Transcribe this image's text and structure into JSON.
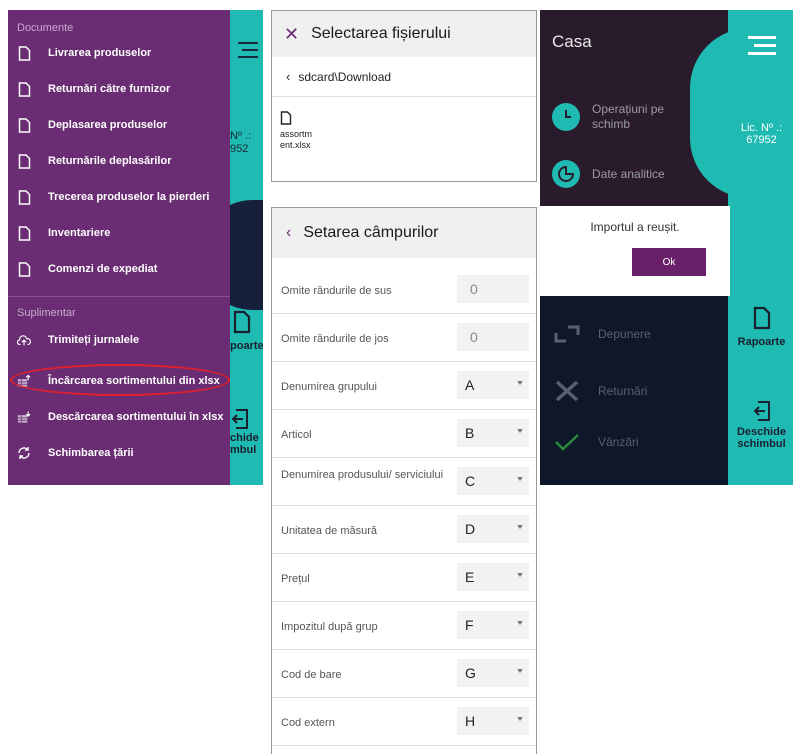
{
  "drawer": {
    "section_documents": "Documente",
    "documents": [
      {
        "label": "Livrarea produselor",
        "icon": "document-icon"
      },
      {
        "label": "Returnări către furnizor",
        "icon": "document-icon"
      },
      {
        "label": "Deplasarea produselor",
        "icon": "document-icon"
      },
      {
        "label": "Returnările deplasărilor",
        "icon": "document-icon"
      },
      {
        "label": "Trecerea produselor la pierderi",
        "icon": "document-icon"
      },
      {
        "label": "Inventariere",
        "icon": "document-icon"
      },
      {
        "label": "Comenzi de expediat",
        "icon": "document-icon"
      }
    ],
    "section_extra": "Suplimentar",
    "extra": [
      {
        "label": "Trimiteți jurnalele",
        "icon": "cloud-upload-icon"
      },
      {
        "label": "Încărcarea sortimentului din xlsx",
        "icon": "spreadsheet-upload-icon"
      },
      {
        "label": "Descărcarea sortimentului în xlsx",
        "icon": "spreadsheet-download-icon"
      },
      {
        "label": "Schimbarea țării",
        "icon": "refresh-icon"
      }
    ],
    "background": {
      "lic_text": "Nº .:",
      "lic_number": "952",
      "reports_fragment": "poarte",
      "open_shift_fragment_1": "chide",
      "open_shift_fragment_2": "mbul"
    }
  },
  "file_selector": {
    "title": "Selectarea fișierului",
    "path": "sdcard\\Download",
    "file_name": "assortm ent.xlsx"
  },
  "field_settings": {
    "title": "Setarea câmpurilor",
    "fields": [
      {
        "label": "Omite rândurile de sus",
        "value": "0",
        "kind": "number"
      },
      {
        "label": "Omite rândurile de jos",
        "value": "0",
        "kind": "number"
      },
      {
        "label": "Denumirea grupului",
        "value": "A",
        "kind": "select"
      },
      {
        "label": "Articol",
        "value": "B",
        "kind": "select"
      },
      {
        "label": "Denumirea produsului/ serviciului",
        "value": "C",
        "kind": "select"
      },
      {
        "label": "Unitatea de măsură",
        "value": "D",
        "kind": "select"
      },
      {
        "label": "Prețul",
        "value": "E",
        "kind": "select"
      },
      {
        "label": "Impozitul după grup",
        "value": "F",
        "kind": "select"
      },
      {
        "label": "Cod de bare",
        "value": "G",
        "kind": "select"
      },
      {
        "label": "Cod extern",
        "value": "H",
        "kind": "select"
      }
    ]
  },
  "main_screen": {
    "title": "Casa",
    "menu_operations": "Operațiuni pe schimb",
    "menu_analytics": "Date analitice",
    "lic_label": "Lic. Nº .:",
    "lic_number": "67952",
    "dialog_message": "Importul a reușit.",
    "dialog_ok": "Ok",
    "deposit": "Depunere",
    "returns": "Returnări",
    "sales": "Vânzări",
    "reports": "Rapoarte",
    "open_shift": "Deschide schimbul"
  },
  "colors": {
    "drawer_purple": "#6a2c72",
    "teal": "#1fbab2",
    "highlight_red": "#e0202a",
    "ok_button": "#6a1f6a"
  }
}
